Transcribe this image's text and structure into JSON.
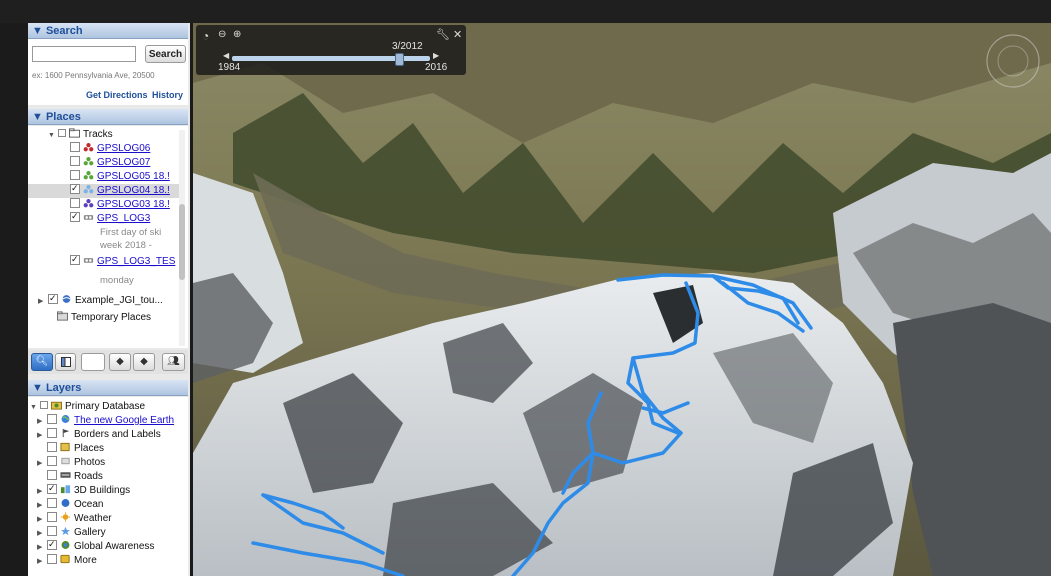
{
  "search": {
    "header": "▼ Search",
    "button": "Search",
    "placeholder": "",
    "example": "ex: 1600 Pennsylvania Ave, 20500",
    "get_directions": "Get Directions",
    "history": "History"
  },
  "places": {
    "header": "▼ Places",
    "tracks_label": "Tracks",
    "items": [
      {
        "label": "GPSLOG06",
        "icon": "track-red-icon"
      },
      {
        "label": "GPSLOG07",
        "icon": "track-green-icon"
      },
      {
        "label": "GPSLOG05 18.!",
        "icon": "track-green-icon"
      },
      {
        "label": "GPSLOG04 18.!",
        "icon": "track-blue-icon"
      },
      {
        "label": "GPSLOG03 18.!",
        "icon": "track-purple-icon"
      },
      {
        "label": "GPS_LOG3",
        "icon": "gps-track-icon"
      },
      {
        "label": "GPS_LOG3_TES",
        "icon": "gps-track-icon"
      }
    ],
    "desc_lines": [
      "First day of ski",
      "week 2018 -",
      "monday"
    ],
    "example_folder": "Example_JGI_tou...",
    "temporary": "Temporary Places"
  },
  "layers": {
    "header": "▼ Layers",
    "primary": "Primary Database",
    "items": [
      {
        "label": "The new Google Earth",
        "link": true,
        "icon": "globe-icon"
      },
      {
        "label": "Borders and Labels",
        "icon": "flag-icon"
      },
      {
        "label": "Places",
        "icon": "places-icon"
      },
      {
        "label": "Photos",
        "icon": "photo-icon"
      },
      {
        "label": "Roads",
        "icon": "roads-icon"
      },
      {
        "label": "3D Buildings",
        "icon": "buildings-icon"
      },
      {
        "label": "Ocean",
        "icon": "ocean-icon"
      },
      {
        "label": "Weather",
        "icon": "weather-icon"
      },
      {
        "label": "Gallery",
        "icon": "gallery-icon"
      },
      {
        "label": "Global Awareness",
        "icon": "awareness-icon"
      },
      {
        "label": "More",
        "icon": "more-icon"
      }
    ]
  },
  "timeslider": {
    "current": "3/2012",
    "start": "1984",
    "end": "2016"
  },
  "colors": {
    "track": "#2e8ce8",
    "header_text": "#1f4f99",
    "link": "#1a0dcc"
  }
}
